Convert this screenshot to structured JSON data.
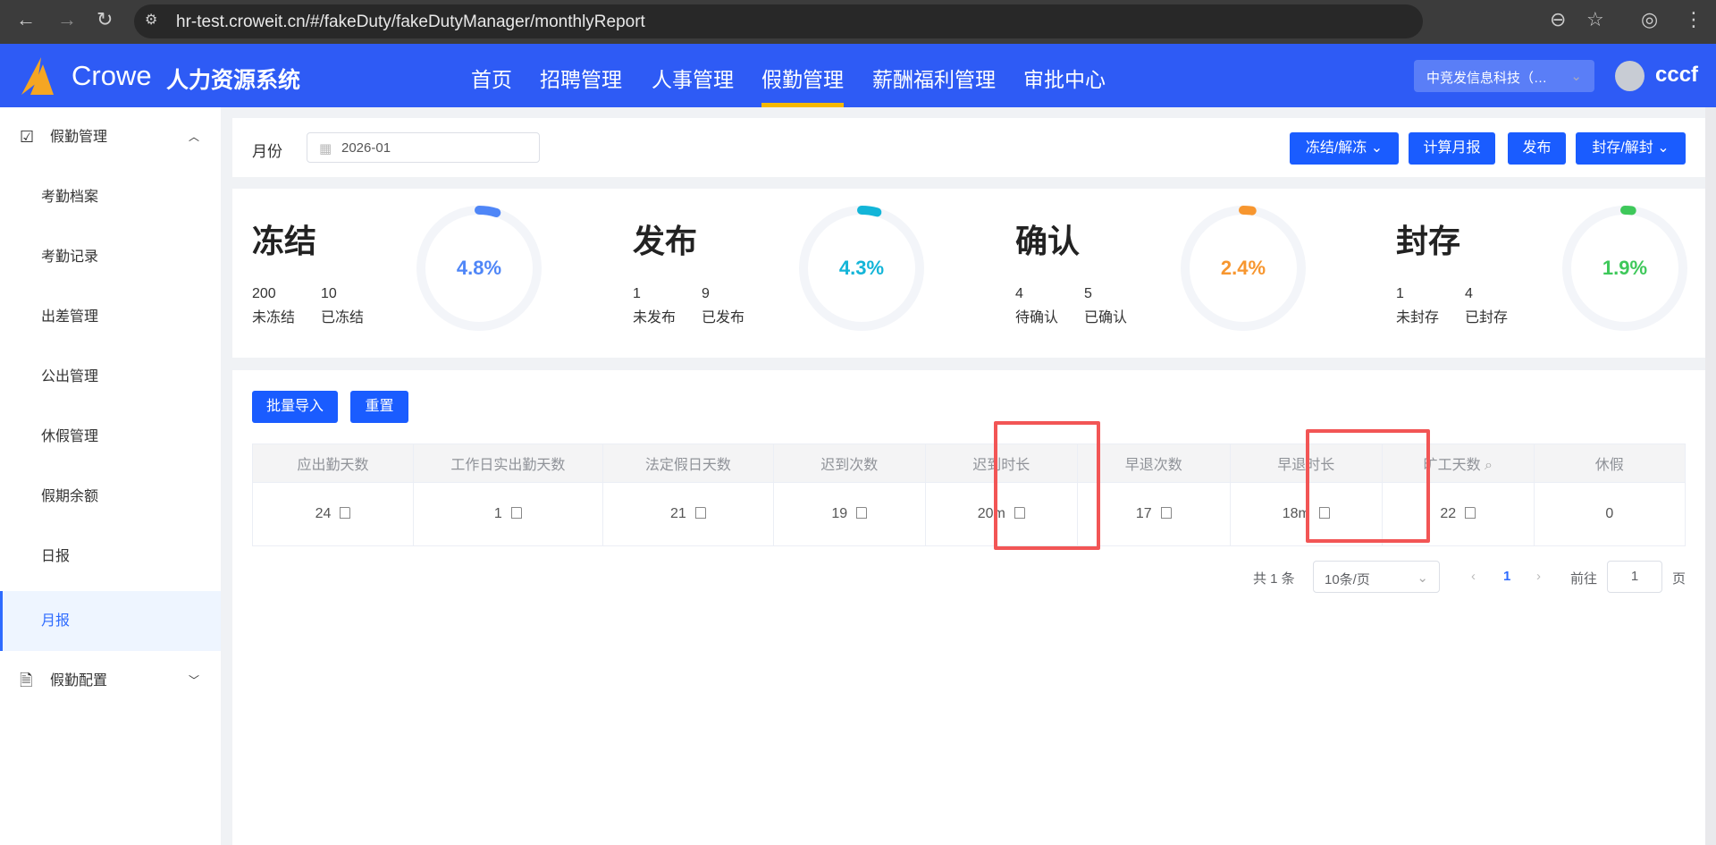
{
  "browser": {
    "url": "hr-test.croweit.cn/#/fakeDuty/fakeDutyManager/monthlyReport"
  },
  "header": {
    "brand": "Crowe",
    "system": "人力资源系统",
    "nav": [
      "首页",
      "招聘管理",
      "人事管理",
      "假勤管理",
      "薪酬福利管理",
      "审批中心"
    ],
    "active_nav": "假勤管理",
    "company": "中竞发信息科技（…",
    "user": "cccf"
  },
  "sidebar": {
    "group": "假勤管理",
    "items": [
      "考勤档案",
      "考勤记录",
      "出差管理",
      "公出管理",
      "休假管理",
      "假期余额",
      "日报",
      "月报"
    ],
    "active": "月报",
    "group2": "假勤配置"
  },
  "filter": {
    "month_label": "月份",
    "month_value": "2026-01",
    "buttons": [
      "冻结/解冻",
      "计算月报",
      "发布",
      "封存/解封"
    ]
  },
  "stats": [
    {
      "title": "冻结",
      "a_num": "200",
      "a_label": "未冻结",
      "b_num": "10",
      "b_label": "已冻结",
      "percent": "4.8%",
      "value": 4.8,
      "color": "#4f86f7"
    },
    {
      "title": "发布",
      "a_num": "1",
      "a_label": "未发布",
      "b_num": "9",
      "b_label": "已发布",
      "percent": "4.3%",
      "value": 4.3,
      "color": "#13b5d8"
    },
    {
      "title": "确认",
      "a_num": "4",
      "a_label": "待确认",
      "b_num": "5",
      "b_label": "已确认",
      "percent": "2.4%",
      "value": 2.4,
      "color": "#f7962f"
    },
    {
      "title": "封存",
      "a_num": "1",
      "a_label": "未封存",
      "b_num": "4",
      "b_label": "已封存",
      "percent": "1.9%",
      "value": 1.9,
      "color": "#3ec85a"
    }
  ],
  "actions": {
    "import": "批量导入",
    "reset": "重置"
  },
  "table": {
    "headers": [
      "应出勤天数",
      "工作日实出勤天数",
      "法定假日天数",
      "迟到次数",
      "迟到时长",
      "早退次数",
      "早退时长",
      "旷工天数",
      "休假"
    ],
    "row": [
      "24",
      "1",
      "21",
      "19",
      "20m",
      "17",
      "18m",
      "22",
      "0"
    ]
  },
  "pagination": {
    "total": "共 1 条",
    "page_size": "10条/页",
    "current": "1",
    "goto_label": "前往",
    "goto_value": "1",
    "page_suffix": "页"
  }
}
